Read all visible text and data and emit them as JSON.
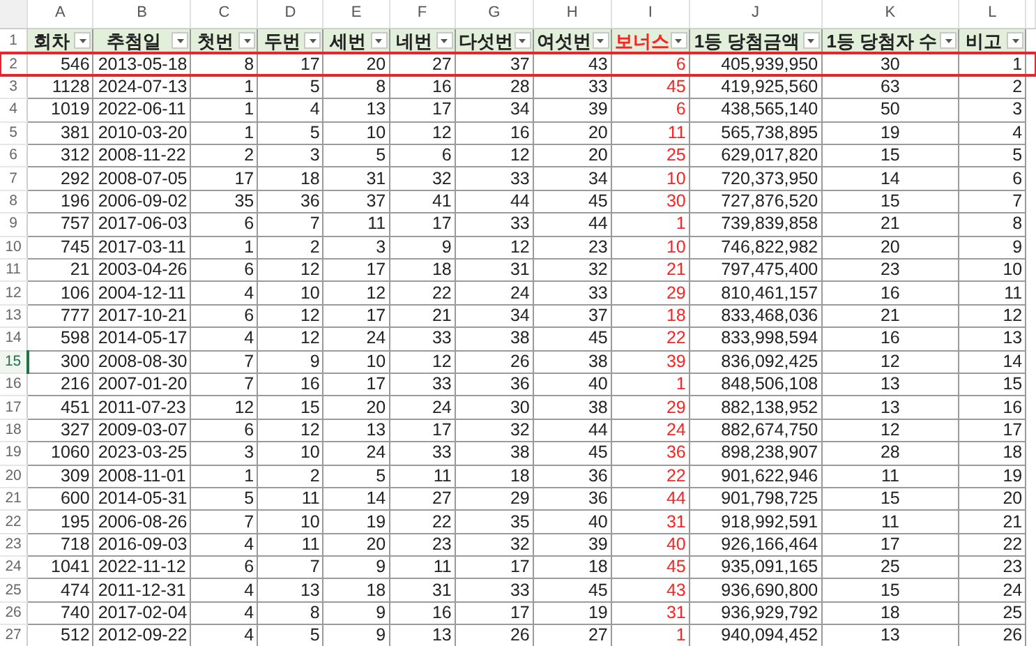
{
  "columns": [
    {
      "letter": "A",
      "title": "회차",
      "kind": "number"
    },
    {
      "letter": "B",
      "title": "추첨일",
      "kind": "date"
    },
    {
      "letter": "C",
      "title": "첫번",
      "kind": "number"
    },
    {
      "letter": "D",
      "title": "두번",
      "kind": "number"
    },
    {
      "letter": "E",
      "title": "세번",
      "kind": "number"
    },
    {
      "letter": "F",
      "title": "네번",
      "kind": "number"
    },
    {
      "letter": "G",
      "title": "다섯번",
      "kind": "number"
    },
    {
      "letter": "H",
      "title": "여섯번",
      "kind": "number"
    },
    {
      "letter": "I",
      "title": "보너스",
      "kind": "bonus"
    },
    {
      "letter": "J",
      "title": "1등 당첨금액",
      "kind": "number"
    },
    {
      "letter": "K",
      "title": "1등 당첨자 수",
      "kind": "center"
    },
    {
      "letter": "L",
      "title": "비고",
      "kind": "number"
    }
  ],
  "header_row_number": "1",
  "rows": [
    {
      "row_number": "2",
      "outlined": true,
      "active": false,
      "cells": [
        "546",
        "2013-05-18",
        "8",
        "17",
        "20",
        "27",
        "37",
        "43",
        "6",
        "405,939,950",
        "30",
        "1"
      ]
    },
    {
      "row_number": "3",
      "outlined": false,
      "active": false,
      "cells": [
        "1128",
        "2024-07-13",
        "1",
        "5",
        "8",
        "16",
        "28",
        "33",
        "45",
        "419,925,560",
        "63",
        "2"
      ]
    },
    {
      "row_number": "4",
      "outlined": false,
      "active": false,
      "cells": [
        "1019",
        "2022-06-11",
        "1",
        "4",
        "13",
        "17",
        "34",
        "39",
        "6",
        "438,565,140",
        "50",
        "3"
      ]
    },
    {
      "row_number": "5",
      "outlined": false,
      "active": false,
      "cells": [
        "381",
        "2010-03-20",
        "1",
        "5",
        "10",
        "12",
        "16",
        "20",
        "11",
        "565,738,895",
        "19",
        "4"
      ]
    },
    {
      "row_number": "6",
      "outlined": false,
      "active": false,
      "cells": [
        "312",
        "2008-11-22",
        "2",
        "3",
        "5",
        "6",
        "12",
        "20",
        "25",
        "629,017,820",
        "15",
        "5"
      ]
    },
    {
      "row_number": "7",
      "outlined": false,
      "active": false,
      "cells": [
        "292",
        "2008-07-05",
        "17",
        "18",
        "31",
        "32",
        "33",
        "34",
        "10",
        "720,373,950",
        "14",
        "6"
      ]
    },
    {
      "row_number": "8",
      "outlined": false,
      "active": false,
      "cells": [
        "196",
        "2006-09-02",
        "35",
        "36",
        "37",
        "41",
        "44",
        "45",
        "30",
        "727,876,520",
        "15",
        "7"
      ]
    },
    {
      "row_number": "9",
      "outlined": false,
      "active": false,
      "cells": [
        "757",
        "2017-06-03",
        "6",
        "7",
        "11",
        "17",
        "33",
        "44",
        "1",
        "739,839,858",
        "21",
        "8"
      ]
    },
    {
      "row_number": "10",
      "outlined": false,
      "active": false,
      "cells": [
        "745",
        "2017-03-11",
        "1",
        "2",
        "3",
        "9",
        "12",
        "23",
        "10",
        "746,822,982",
        "20",
        "9"
      ]
    },
    {
      "row_number": "11",
      "outlined": false,
      "active": false,
      "cells": [
        "21",
        "2003-04-26",
        "6",
        "12",
        "17",
        "18",
        "31",
        "32",
        "21",
        "797,475,400",
        "23",
        "10"
      ]
    },
    {
      "row_number": "12",
      "outlined": false,
      "active": false,
      "cells": [
        "106",
        "2004-12-11",
        "4",
        "10",
        "12",
        "22",
        "24",
        "33",
        "29",
        "810,461,157",
        "16",
        "11"
      ]
    },
    {
      "row_number": "13",
      "outlined": false,
      "active": false,
      "cells": [
        "777",
        "2017-10-21",
        "6",
        "12",
        "17",
        "21",
        "34",
        "37",
        "18",
        "833,468,036",
        "21",
        "12"
      ]
    },
    {
      "row_number": "14",
      "outlined": false,
      "active": false,
      "cells": [
        "598",
        "2014-05-17",
        "4",
        "12",
        "24",
        "33",
        "38",
        "45",
        "22",
        "833,998,594",
        "16",
        "13"
      ]
    },
    {
      "row_number": "15",
      "outlined": false,
      "active": true,
      "cells": [
        "300",
        "2008-08-30",
        "7",
        "9",
        "10",
        "12",
        "26",
        "38",
        "39",
        "836,092,425",
        "12",
        "14"
      ]
    },
    {
      "row_number": "16",
      "outlined": false,
      "active": false,
      "cells": [
        "216",
        "2007-01-20",
        "7",
        "16",
        "17",
        "33",
        "36",
        "40",
        "1",
        "848,506,108",
        "13",
        "15"
      ]
    },
    {
      "row_number": "17",
      "outlined": false,
      "active": false,
      "cells": [
        "451",
        "2011-07-23",
        "12",
        "15",
        "20",
        "24",
        "30",
        "38",
        "29",
        "882,138,952",
        "13",
        "16"
      ]
    },
    {
      "row_number": "18",
      "outlined": false,
      "active": false,
      "cells": [
        "327",
        "2009-03-07",
        "6",
        "12",
        "13",
        "17",
        "32",
        "44",
        "24",
        "882,674,750",
        "12",
        "17"
      ]
    },
    {
      "row_number": "19",
      "outlined": false,
      "active": false,
      "cells": [
        "1060",
        "2023-03-25",
        "3",
        "10",
        "24",
        "33",
        "38",
        "45",
        "36",
        "898,238,907",
        "28",
        "18"
      ]
    },
    {
      "row_number": "20",
      "outlined": false,
      "active": false,
      "cells": [
        "309",
        "2008-11-01",
        "1",
        "2",
        "5",
        "11",
        "18",
        "36",
        "22",
        "901,622,946",
        "11",
        "19"
      ]
    },
    {
      "row_number": "21",
      "outlined": false,
      "active": false,
      "cells": [
        "600",
        "2014-05-31",
        "5",
        "11",
        "14",
        "27",
        "29",
        "36",
        "44",
        "901,798,725",
        "15",
        "20"
      ]
    },
    {
      "row_number": "22",
      "outlined": false,
      "active": false,
      "cells": [
        "195",
        "2006-08-26",
        "7",
        "10",
        "19",
        "22",
        "35",
        "40",
        "31",
        "918,992,591",
        "11",
        "21"
      ]
    },
    {
      "row_number": "23",
      "outlined": false,
      "active": false,
      "cells": [
        "718",
        "2016-09-03",
        "4",
        "11",
        "20",
        "23",
        "32",
        "39",
        "40",
        "926,166,464",
        "17",
        "22"
      ]
    },
    {
      "row_number": "24",
      "outlined": false,
      "active": false,
      "cells": [
        "1041",
        "2022-11-12",
        "6",
        "7",
        "9",
        "11",
        "17",
        "18",
        "45",
        "935,091,165",
        "25",
        "23"
      ]
    },
    {
      "row_number": "25",
      "outlined": false,
      "active": false,
      "cells": [
        "474",
        "2011-12-31",
        "4",
        "13",
        "18",
        "31",
        "33",
        "45",
        "43",
        "936,690,800",
        "15",
        "24"
      ]
    },
    {
      "row_number": "26",
      "outlined": false,
      "active": false,
      "cells": [
        "740",
        "2017-02-04",
        "4",
        "8",
        "9",
        "16",
        "17",
        "19",
        "31",
        "936,929,792",
        "18",
        "25"
      ]
    },
    {
      "row_number": "27",
      "outlined": false,
      "active": false,
      "cells": [
        "512",
        "2012-09-22",
        "4",
        "5",
        "9",
        "13",
        "26",
        "27",
        "1",
        "940,094,452",
        "13",
        "26"
      ]
    }
  ]
}
